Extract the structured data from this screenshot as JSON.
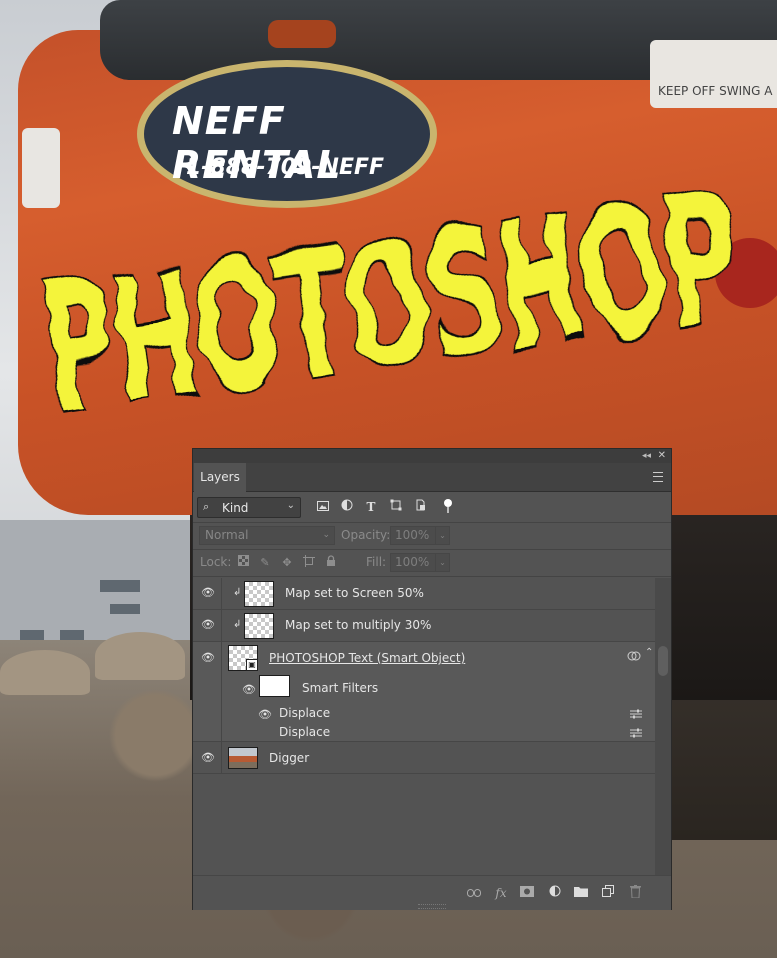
{
  "photo": {
    "logo_name": "NEFF RENTAL",
    "logo_phone": "1-888-709-NEFF",
    "sticker_text": "KEEP OFF SWING A",
    "overlay_text": "PHOTOSHOP",
    "overlay_fill": "#f4f43a"
  },
  "panel": {
    "title_tab": "Layers",
    "controls": {
      "collapse": "◂◂",
      "close": "✕"
    },
    "filter": {
      "kind_label": "Kind",
      "search_icon": "⌕",
      "chevron": "⌄"
    },
    "filter_icons": [
      "image-filter-icon",
      "adjustment-filter-icon",
      "type-filter-icon",
      "shape-filter-icon",
      "smart-object-filter-icon",
      "filter-toggle-icon"
    ],
    "blend_mode": "Normal",
    "opacity_label": "Opacity:",
    "opacity_value": "100%",
    "lock_label": "Lock:",
    "fill_label": "Fill:",
    "fill_value": "100%",
    "layers": [
      {
        "name": "Map set to Screen 50%",
        "visible": true,
        "clipped": true
      },
      {
        "name": "Map set to multiply 30%",
        "visible": true,
        "clipped": true
      },
      {
        "name": "PHOTOSHOP Text (Smart Object)",
        "visible": true,
        "smart_object": true
      },
      {
        "name": "Digger",
        "visible": true
      }
    ],
    "smart_filters_label": "Smart Filters",
    "filters": [
      {
        "name": "Displace",
        "visible": true
      },
      {
        "name": "Displace",
        "visible": false
      }
    ],
    "bottom_icons": [
      "link-layers-icon",
      "fx-icon",
      "add-mask-icon",
      "new-adjustment-icon",
      "new-group-icon",
      "new-layer-icon",
      "delete-layer-icon"
    ],
    "accent": "#535353"
  }
}
